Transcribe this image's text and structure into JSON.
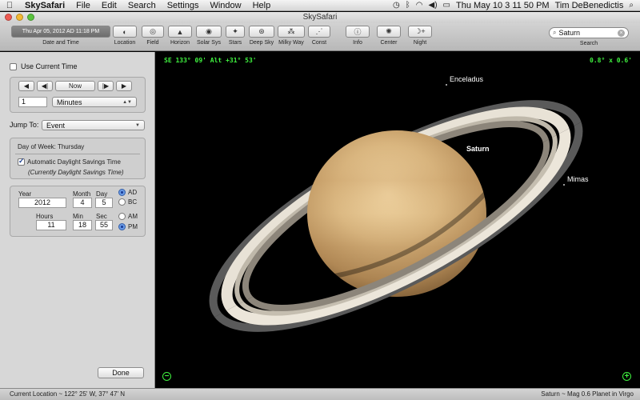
{
  "menubar": {
    "app": "SkySafari",
    "items": [
      "File",
      "Edit",
      "Search",
      "Settings",
      "Window",
      "Help"
    ],
    "clock": "Thu May 10   3 11 50 PM",
    "user": "Tim DeBenedictis"
  },
  "window": {
    "title": "SkySafari"
  },
  "toolbar": {
    "date_value": "Thu Apr 05, 2012 AD 11:18 PM",
    "date_label": "Date and Time",
    "location": "Location",
    "field": "Field",
    "horizon": "Horizon",
    "solar_sys": "Solar Sys",
    "stars": "Stars",
    "deep_sky": "Deep Sky",
    "milky_way": "Milky Way",
    "const": "Const",
    "info": "Info",
    "center": "Center",
    "night": "Night",
    "search_value": "Saturn",
    "search_label": "Search"
  },
  "sidebar": {
    "use_current_time": "Use Current Time",
    "now": "Now",
    "step_value": "1",
    "step_unit": "Minutes",
    "jump_to": "Jump To:",
    "jump_value": "Event",
    "day_of_week": "Day of Week:  Thursday",
    "auto_dst": "Automatic Daylight Savings Time",
    "dst_note": "(Currently Daylight Savings Time)",
    "year_label": "Year",
    "month_label": "Month",
    "day_label": "Day",
    "year": "2012",
    "month": "4",
    "day": "5",
    "ad": "AD",
    "bc": "BC",
    "hours_label": "Hours",
    "min_label": "Min",
    "sec_label": "Sec",
    "hours": "11",
    "min": "18",
    "sec": "55",
    "am": "AM",
    "pm": "PM",
    "done": "Done"
  },
  "sky": {
    "coords": "SE 133° 09' Alt +31° 53'",
    "fov": "0.8° x  0.6'",
    "labels": {
      "enceladus": "Enceladus",
      "saturn": "Saturn",
      "mimas": "Mimas"
    }
  },
  "status": {
    "location": "Current Location ~ 122° 25' W, 37° 47' N",
    "object": "Saturn ~ Mag 0.6 Planet in Virgo"
  }
}
